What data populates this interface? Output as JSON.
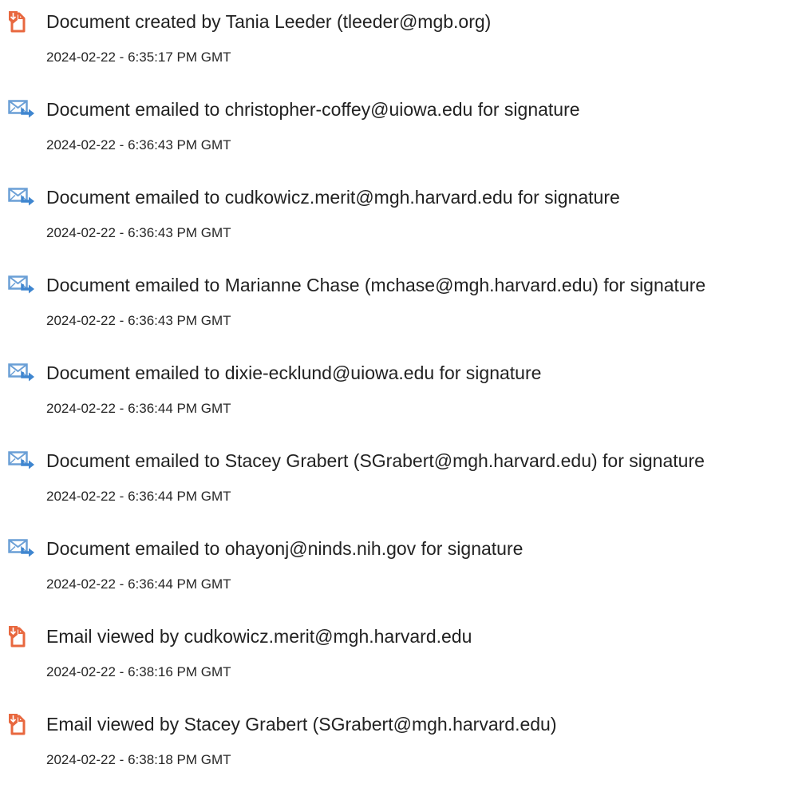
{
  "colors": {
    "doc_icon": "#e8683f",
    "mail_icon": "#6a9fd6",
    "mail_arrow": "#3f86d0",
    "text": "#222222"
  },
  "events": [
    {
      "icon": "document-icon",
      "text": "Document created by Tania Leeder (tleeder@mgb.org)",
      "time": "2024-02-22 - 6:35:17 PM GMT"
    },
    {
      "icon": "email-sent-icon",
      "text": "Document emailed to christopher-coffey@uiowa.edu for signature",
      "time": "2024-02-22 - 6:36:43 PM GMT"
    },
    {
      "icon": "email-sent-icon",
      "text": "Document emailed to cudkowicz.merit@mgh.harvard.edu for signature",
      "time": "2024-02-22 - 6:36:43 PM GMT"
    },
    {
      "icon": "email-sent-icon",
      "text": "Document emailed to Marianne Chase (mchase@mgh.harvard.edu) for signature",
      "time": "2024-02-22 - 6:36:43 PM GMT"
    },
    {
      "icon": "email-sent-icon",
      "text": "Document emailed to dixie-ecklund@uiowa.edu for signature",
      "time": "2024-02-22 - 6:36:44 PM GMT"
    },
    {
      "icon": "email-sent-icon",
      "text": "Document emailed to Stacey Grabert (SGrabert@mgh.harvard.edu) for signature",
      "time": "2024-02-22 - 6:36:44 PM GMT"
    },
    {
      "icon": "email-sent-icon",
      "text": "Document emailed to ohayonj@ninds.nih.gov for signature",
      "time": "2024-02-22 - 6:36:44 PM GMT"
    },
    {
      "icon": "document-icon",
      "text": "Email viewed by cudkowicz.merit@mgh.harvard.edu",
      "time": "2024-02-22 - 6:38:16 PM GMT"
    },
    {
      "icon": "document-icon",
      "text": "Email viewed by Stacey Grabert (SGrabert@mgh.harvard.edu)",
      "time": "2024-02-22 - 6:38:18 PM GMT"
    }
  ]
}
